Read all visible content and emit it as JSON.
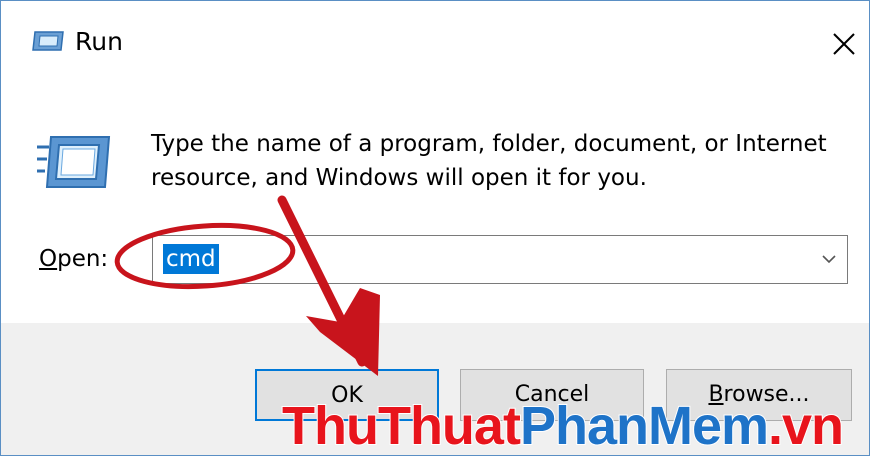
{
  "window": {
    "title": "Run",
    "close_icon": "close-icon",
    "app_icon": "run-app-icon"
  },
  "content": {
    "description": "Type the name of a program, folder, document, or Internet resource, and Windows will open it for you.",
    "open_label_mnemonic": "O",
    "open_label_rest": "pen:",
    "open_value": "cmd",
    "dropdown_icon": "chevron-down-icon"
  },
  "buttons": {
    "ok": "OK",
    "cancel": "Cancel",
    "browse_mnemonic": "B",
    "browse_rest": "rowse..."
  },
  "watermark": {
    "part1": "ThuThuat",
    "part2": "PhanMem",
    "part3": ".vn"
  },
  "colors": {
    "accent": "#0078d7",
    "annotation": "#c8141c",
    "watermark_red": "#e8141c",
    "watermark_blue": "#1e73c8"
  }
}
